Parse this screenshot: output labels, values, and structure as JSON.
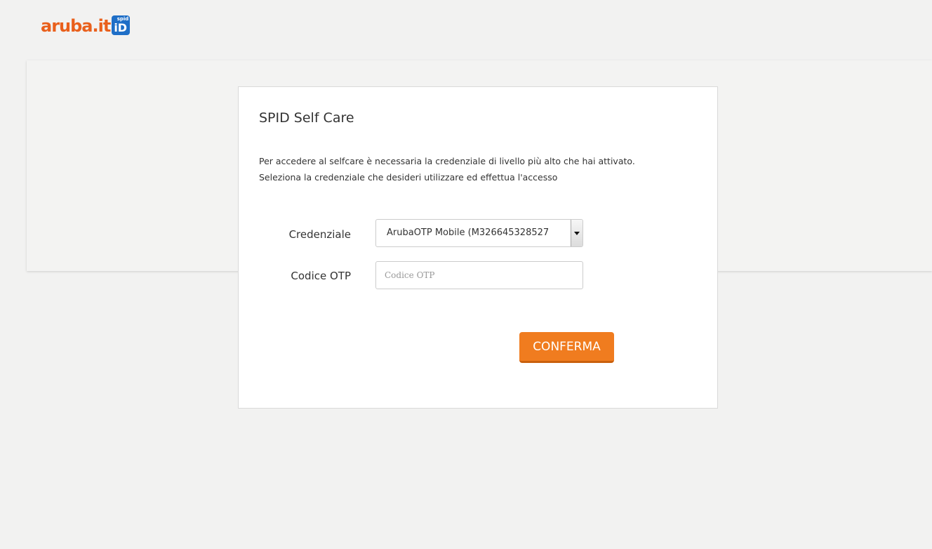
{
  "header": {
    "logo_text": "aruba.it",
    "logo_badge_top": "spid",
    "logo_badge_main": "iD"
  },
  "card": {
    "title": "SPID Self Care",
    "description_line1": "Per accedere al selfcare è necessaria la credenziale di livello più alto che hai attivato.",
    "description_line2": "Seleziona la credenziale che desideri utilizzare ed effettua l'accesso"
  },
  "form": {
    "credential_label": "Credenziale",
    "credential_selected": "ArubaOTP Mobile (M326645328527",
    "otp_label": "Codice OTP",
    "otp_placeholder": "Codice OTP",
    "otp_value": "",
    "confirm_label": "CONFERMA"
  },
  "colors": {
    "brand_orange": "#f07c1f",
    "badge_blue": "#1f6fc7",
    "background": "#f2f2f1"
  },
  "icons": {
    "select_arrow": "chevron-down-icon"
  }
}
